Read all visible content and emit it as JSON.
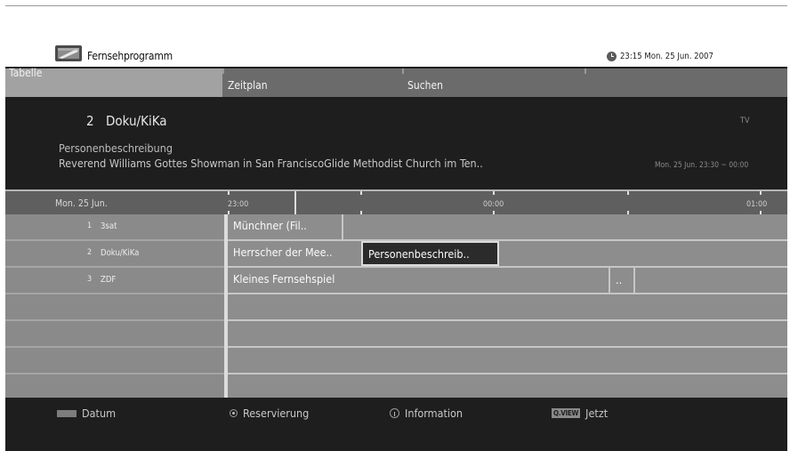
{
  "header": {
    "app_title": "Fernsehprogramm",
    "app_icon": "tv-guide-icon",
    "clock_icon": "clock-icon",
    "datetime": "23:15 Mon. 25 Jun. 2007"
  },
  "tabs": [
    {
      "label": "Tabelle",
      "active": true
    },
    {
      "label": "Zeitplan",
      "active": false
    },
    {
      "label": "Suchen",
      "active": false
    }
  ],
  "info": {
    "channel_number": "2",
    "channel_name": "Doku/KiKa",
    "type": "TV",
    "program_title": "Personenbeschreibung",
    "program_description": "Reverend Williams Gottes Showman in San FranciscoGlide Methodist Church im Ten..",
    "program_time": "Mon. 25 Jun. 23:30 ~ 00:00"
  },
  "grid": {
    "date": "Mon. 25 Jun.",
    "timeline": [
      "23:00",
      "00:00",
      "01:00"
    ],
    "channels": [
      {
        "number": "1",
        "name": "3sat"
      },
      {
        "number": "2",
        "name": "Doku/KiKa"
      },
      {
        "number": "3",
        "name": "ZDF"
      }
    ],
    "programs": {
      "row1": [
        "Münchner (Fil.."
      ],
      "row2": [
        "Herrscher der Mee..",
        "Personenbeschreib.."
      ],
      "row3": [
        "Kleines Fernsehspiel",
        ".."
      ]
    }
  },
  "footer": {
    "datum": "Datum",
    "reservierung": "Reservierung",
    "information": "Information",
    "qview_key": "Q.VIEW",
    "jetzt": "Jetzt"
  },
  "colors": {
    "background": "#1e1e1e",
    "active_tab": "#a2a2a2",
    "grid": "#8d8d8d",
    "selected_program": "#2b2b2b"
  }
}
